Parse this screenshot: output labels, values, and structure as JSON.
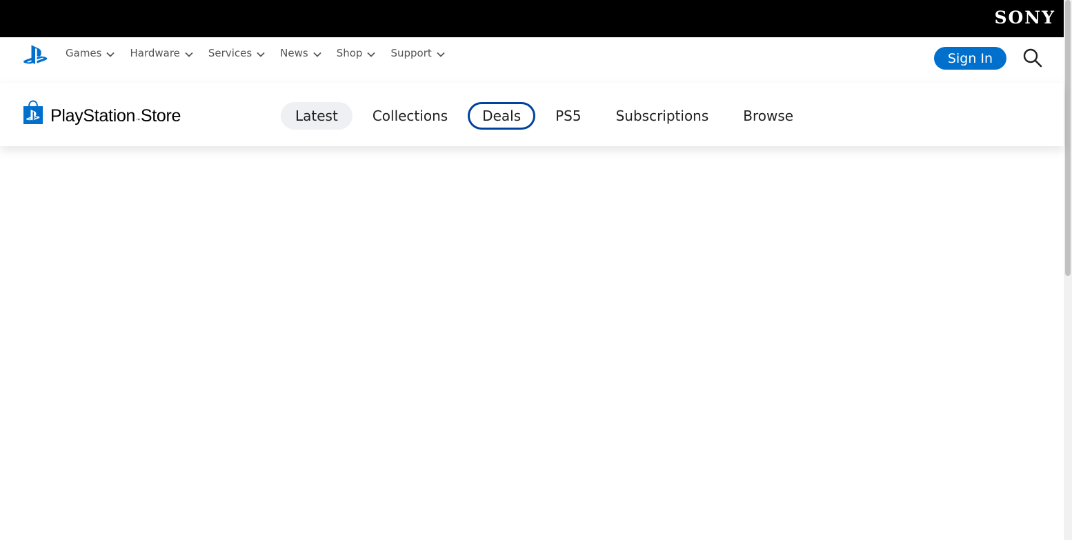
{
  "sony_bar": {
    "logo_text": "SONY"
  },
  "global_nav": {
    "items": [
      {
        "label": "Games"
      },
      {
        "label": "Hardware"
      },
      {
        "label": "Services"
      },
      {
        "label": "News"
      },
      {
        "label": "Shop"
      },
      {
        "label": "Support"
      }
    ],
    "sign_in_label": "Sign In",
    "icons": {
      "logo": "playstation-logo-icon",
      "search": "search-icon",
      "dropdown": "chevron-down-icon"
    }
  },
  "store_nav": {
    "title_bold": "PlayStation",
    "title_light": "Store",
    "tabs": [
      {
        "label": "Latest",
        "state": "active"
      },
      {
        "label": "Collections",
        "state": ""
      },
      {
        "label": "Deals",
        "state": "focused"
      },
      {
        "label": "PS5",
        "state": ""
      },
      {
        "label": "Subscriptions",
        "state": ""
      },
      {
        "label": "Browse",
        "state": ""
      }
    ],
    "icons": {
      "bag": "store-bag-icon"
    }
  },
  "colors": {
    "sony_bar": "#000000",
    "accent": "#0070cc",
    "focus_ring": "#00439c",
    "active_tab_bg": "#eef0f3"
  }
}
